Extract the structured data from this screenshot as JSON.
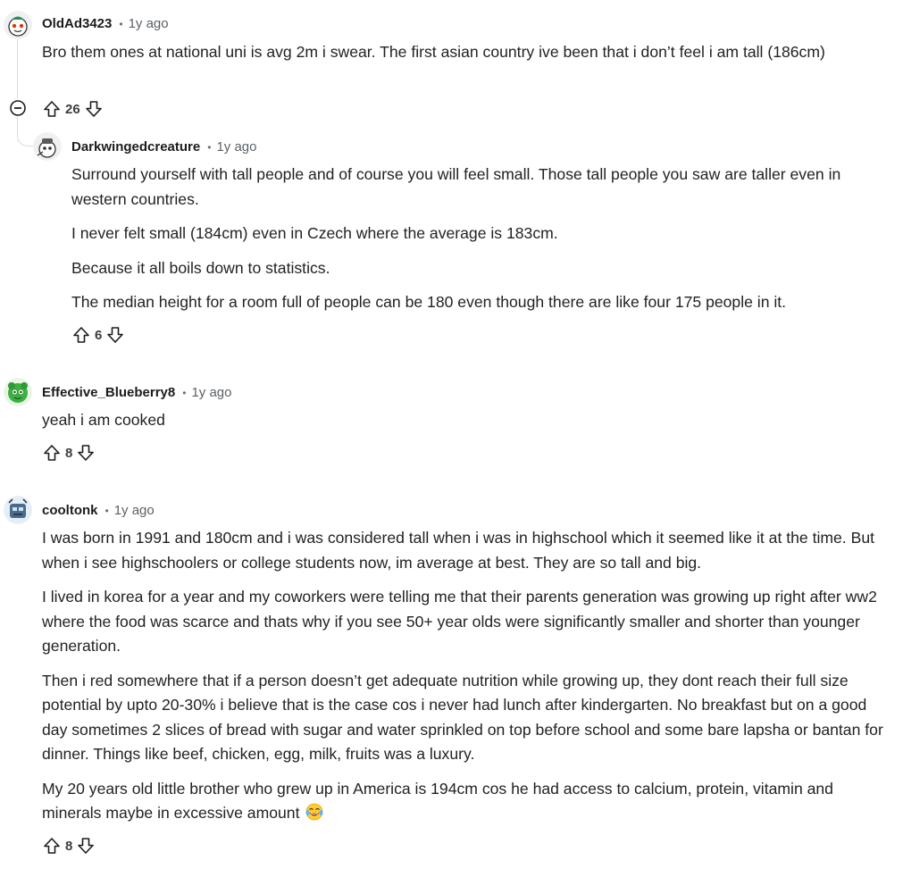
{
  "comments": [
    {
      "username": "OldAd3423",
      "separator": "•",
      "age": "1y ago",
      "paragraphs": [
        "Bro them ones at national uni is avg 2m i swear. The first asian country ive been that i don’t feel i am tall (186cm)"
      ],
      "score": "26"
    },
    {
      "username": "Darkwingedcreature",
      "separator": "•",
      "age": "1y ago",
      "paragraphs": [
        "Surround yourself with tall people and of course you will feel small. Those tall people you saw are taller even in western countries.",
        "I never felt small (184cm) even in Czech where the average is 183cm.",
        "Because it all boils down to statistics.",
        "The median height for a room full of people can be 180 even though there are like four 175 people in it."
      ],
      "score": "6"
    },
    {
      "username": "Effective_Blueberry8",
      "separator": "•",
      "age": "1y ago",
      "paragraphs": [
        "yeah i am cooked"
      ],
      "score": "8"
    },
    {
      "username": "cooltonk",
      "separator": "•",
      "age": "1y ago",
      "paragraphs": [
        "I was born in 1991 and 180cm and i was considered tall when i was in highschool which it seemed like it at the time. But when i see highschoolers or college students now, im average at best. They are so tall and big.",
        "I lived in korea for a year and my coworkers were telling me that their parents generation was growing up right after ww2 where the food was scarce and thats why if you see 50+ year olds were significantly smaller and shorter than younger generation.",
        "Then i red somewhere that if a person doesn’t get adequate nutrition while growing up, they dont reach their full size potential by upto 20-30% i believe that is the case cos i never had lunch after kindergarten. No breakfast but on a good day sometimes 2 slices of bread with sugar and water sprinkled on top before school and some bare lapsha or bantan for dinner. Things like beef, chicken, egg, milk, fruits was a luxury.",
        "My 20 years old little brother who grew up in America is 194cm cos he had access to calcium, protein, vitamin and minerals maybe in excessive amount"
      ],
      "score": "8"
    }
  ],
  "colors": {
    "text": "#1c1c1c",
    "meta": "#5c6166",
    "thread_line": "#d8dcdf"
  },
  "icons": [
    "upvote-icon",
    "downvote-icon",
    "collapse-icon",
    "laughing-emoji-icon"
  ]
}
